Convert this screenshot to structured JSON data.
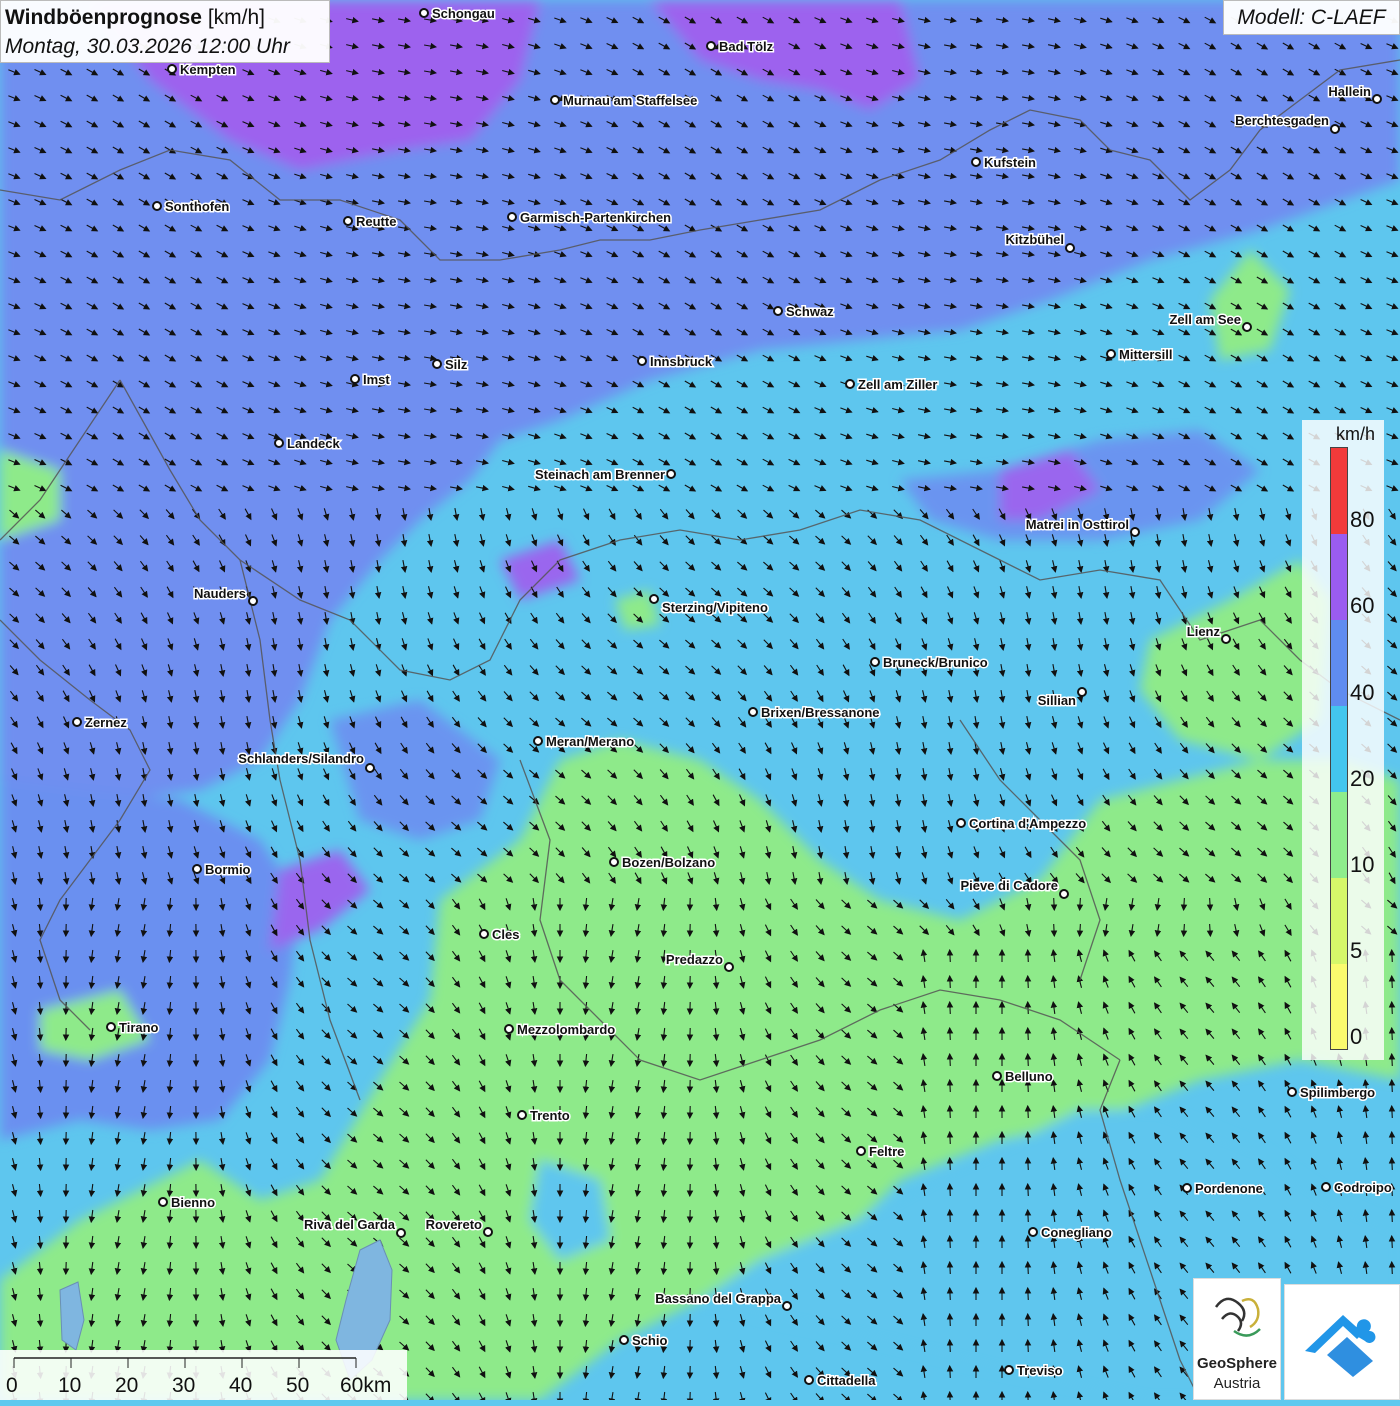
{
  "header": {
    "title": "Windböenprognose",
    "unit_label": "[km/h]",
    "datetime": "Montag, 30.03.2026 12:00 Uhr",
    "model": "Modell: C-LAEF"
  },
  "legend": {
    "unit": "km/h",
    "labels": [
      "80",
      "60",
      "40",
      "20",
      "10",
      "5",
      "0"
    ],
    "colors": {
      "band_0_5": "#fbfb6e",
      "band_5_10": "#d6f76a",
      "band_10_20": "#8eed8c",
      "band_20_40": "#43c6ee",
      "band_40_60": "#5f8cf0",
      "band_60_80": "#9a5cf0",
      "band_80_plus": "#f23a3a"
    }
  },
  "scalebar": {
    "ticks": [
      "0",
      "10",
      "20",
      "30",
      "40",
      "50",
      "60km"
    ]
  },
  "logo": {
    "name": "GeoSphere",
    "country": "Austria"
  },
  "cities": [
    {
      "name": "Schongau"
    },
    {
      "name": "Kempten"
    },
    {
      "name": "Bad Tölz"
    },
    {
      "name": "Murnau am Staffelsee"
    },
    {
      "name": "Hallein"
    },
    {
      "name": "Berchtesgaden"
    },
    {
      "name": "Kufstein"
    },
    {
      "name": "Sonthofen"
    },
    {
      "name": "Reutte"
    },
    {
      "name": "Garmisch-Partenkirchen"
    },
    {
      "name": "Kitzbühel"
    },
    {
      "name": "Schwaz"
    },
    {
      "name": "Zell am See"
    },
    {
      "name": "Mittersill"
    },
    {
      "name": "Innsbruck"
    },
    {
      "name": "Imst"
    },
    {
      "name": "Silz"
    },
    {
      "name": "Zell am Ziller"
    },
    {
      "name": "Landeck"
    },
    {
      "name": "Steinach am Brenner"
    },
    {
      "name": "Matrei in Osttirol"
    },
    {
      "name": "Nauders"
    },
    {
      "name": "Sterzing/Vipiteno"
    },
    {
      "name": "Lienz"
    },
    {
      "name": "Bruneck/Brunico"
    },
    {
      "name": "Sillian"
    },
    {
      "name": "Brixen/Bressanone"
    },
    {
      "name": "Zernez"
    },
    {
      "name": "Meran/Merano"
    },
    {
      "name": "Schlanders/Silandro"
    },
    {
      "name": "Cortina d'Ampezzo"
    },
    {
      "name": "Bozen/Bolzano"
    },
    {
      "name": "Bormio"
    },
    {
      "name": "Pieve di Cadore"
    },
    {
      "name": "Cles"
    },
    {
      "name": "Predazzo"
    },
    {
      "name": "Tirano"
    },
    {
      "name": "Mezzolombardo"
    },
    {
      "name": "Belluno"
    },
    {
      "name": "Spilimbergo"
    },
    {
      "name": "Trento"
    },
    {
      "name": "Feltre"
    },
    {
      "name": "Pordenone"
    },
    {
      "name": "Codroipo"
    },
    {
      "name": "Bienno"
    },
    {
      "name": "Riva del Garda"
    },
    {
      "name": "Rovereto"
    },
    {
      "name": "Conegliano"
    },
    {
      "name": "Bassano del Grappa"
    },
    {
      "name": "Schio"
    },
    {
      "name": "Treviso"
    },
    {
      "name": "Cittadella"
    }
  ]
}
